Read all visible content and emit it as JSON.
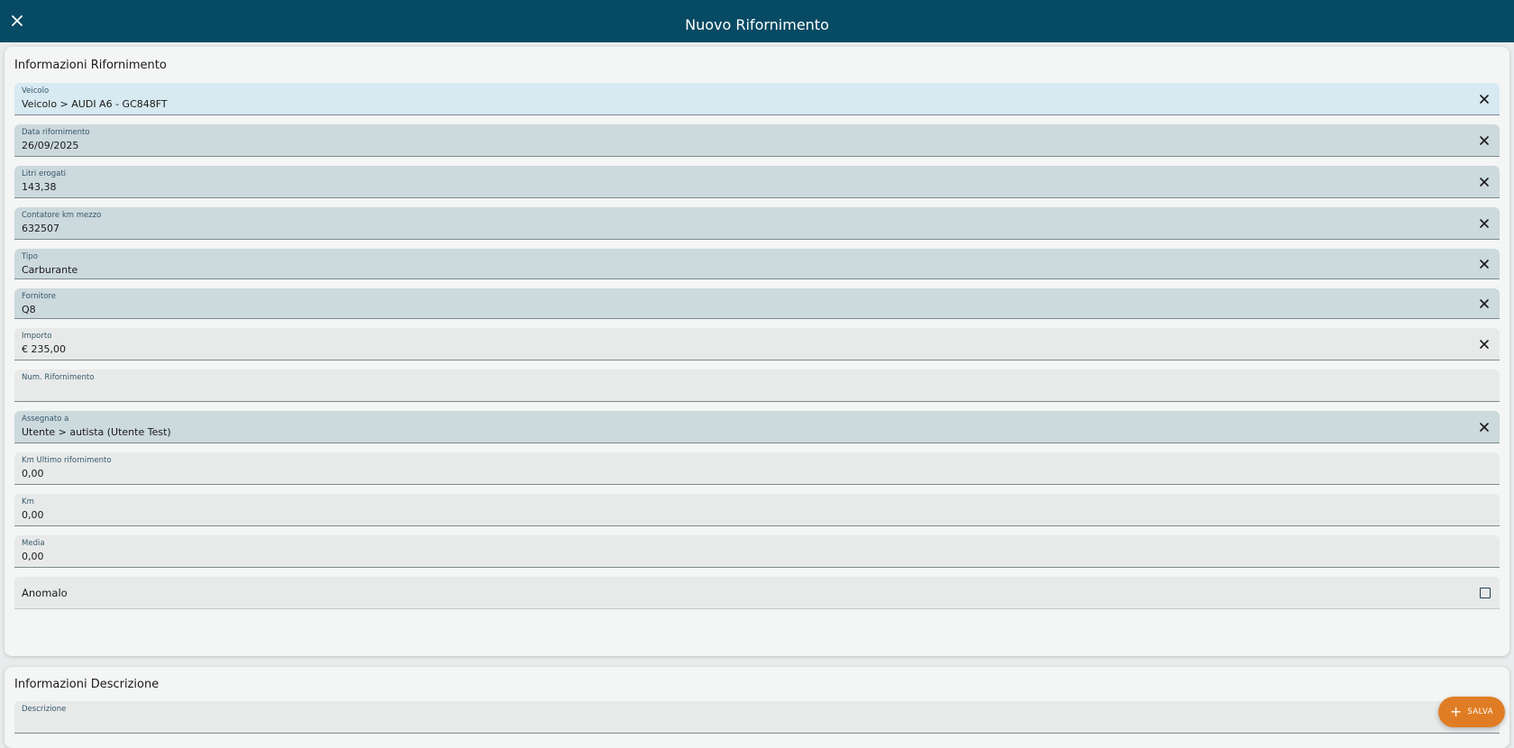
{
  "header": {
    "title": "Nuovo Rifornimento",
    "close_icon": "close-icon"
  },
  "section_info": {
    "title": "Informazioni Rifornimento",
    "fields": {
      "veicolo": {
        "label": "Veicolo",
        "value": "Veicolo > AUDI A6 - GC848FT"
      },
      "data": {
        "label": "Data rifornimento",
        "value": "26/09/2025"
      },
      "litri": {
        "label": "Litri erogati",
        "value": "143,38"
      },
      "contatore": {
        "label": "Contatore km mezzo",
        "value": "632507"
      },
      "tipo": {
        "label": "Tipo",
        "value": "Carburante"
      },
      "fornitore": {
        "label": "Fornitore",
        "value": "Q8"
      },
      "importo": {
        "label": "Importo",
        "value": "€ 235,00"
      },
      "num_rif": {
        "label": "Num. Rifornimento",
        "value": ""
      },
      "assegnato": {
        "label": "Assegnato a",
        "value": "Utente > autista (Utente Test)"
      },
      "km_ultimo": {
        "label": "Km Ultimo rifornimento",
        "value": "0,00"
      },
      "km": {
        "label": "Km",
        "value": "0,00"
      },
      "media": {
        "label": "Media",
        "value": "0,00"
      },
      "anomalo": {
        "label": "Anomalo",
        "checked": false
      }
    }
  },
  "section_desc": {
    "title": "Informazioni Descrizione",
    "fields": {
      "descrizione": {
        "label": "Descrizione",
        "value": ""
      }
    }
  },
  "fab": {
    "label": "SALVA",
    "icon": "plus-icon"
  },
  "colors": {
    "header_bg": "#074a63",
    "fab_bg": "#e07d24",
    "field_filled_bg": "#ccd9dd",
    "field_focused_bg": "#d7e9f1"
  }
}
